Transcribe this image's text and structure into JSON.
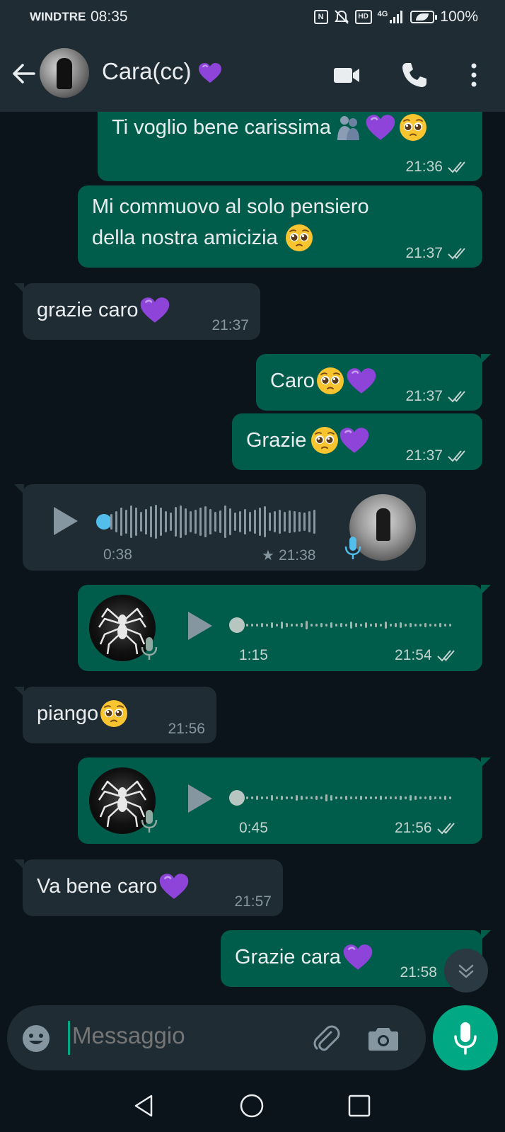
{
  "status_bar": {
    "carrier": "WINDTRE",
    "time": "08:35",
    "network": "4G",
    "hd": "HD",
    "nfc": "N",
    "battery": "100%"
  },
  "header": {
    "contact_name": "Cara(cc)",
    "icons": [
      "back-arrow-icon",
      "video-call-icon",
      "phone-icon",
      "more-vert-icon"
    ]
  },
  "messages": [
    {
      "dir": "out",
      "text": "Ti voglio bene carissima",
      "emojis": [
        "hugging-people-emoji",
        "purple-heart-emoji",
        "pleading-face-emoji"
      ],
      "time": "21:36",
      "status": "read"
    },
    {
      "dir": "out",
      "text_line1": "Mi commuovo al solo pensiero",
      "text_line2": "della nostra amicizia",
      "emojis": [
        "pleading-face-emoji"
      ],
      "time": "21:37",
      "status": "read"
    },
    {
      "dir": "in",
      "text": "grazie caro",
      "emojis": [
        "purple-heart-emoji"
      ],
      "time": "21:37"
    },
    {
      "dir": "out",
      "text": "Caro",
      "emojis": [
        "pleading-face-emoji",
        "purple-heart-emoji"
      ],
      "time": "21:37",
      "status": "read"
    },
    {
      "dir": "out",
      "text": "Grazie",
      "emojis": [
        "pleading-face-emoji",
        "purple-heart-emoji"
      ],
      "time": "21:37",
      "status": "read"
    },
    {
      "dir": "in",
      "type": "voice",
      "duration": "0:38",
      "starred": true,
      "time": "21:38"
    },
    {
      "dir": "out",
      "type": "voice",
      "duration": "1:15",
      "time": "21:54",
      "status": "read"
    },
    {
      "dir": "in",
      "text": "piango",
      "emojis": [
        "pleading-face-emoji"
      ],
      "time": "21:56"
    },
    {
      "dir": "out",
      "type": "voice",
      "duration": "0:45",
      "time": "21:56",
      "status": "read"
    },
    {
      "dir": "in",
      "text": "Va bene caro",
      "emojis": [
        "purple-heart-emoji"
      ],
      "time": "21:57"
    },
    {
      "dir": "out",
      "text": "Grazie cara",
      "emojis": [
        "purple-heart-emoji"
      ],
      "time": "21:58"
    }
  ],
  "input": {
    "placeholder": "Messaggio"
  },
  "colors": {
    "background": "#0b141a",
    "header": "#1f2c34",
    "outgoing_bubble": "#005c4b",
    "incoming_bubble": "#202c33",
    "accent": "#00a884",
    "read_ticks": "#c4d3cf",
    "voice_dot_incoming": "#53bdeb",
    "purple_heart": "#8e44d8"
  }
}
